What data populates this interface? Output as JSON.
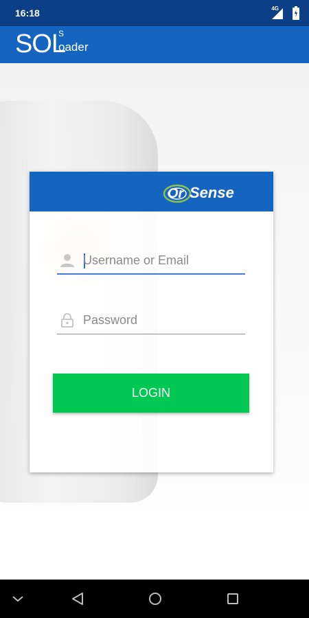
{
  "status_bar": {
    "time": "16:18",
    "network": "4G",
    "icons": [
      "signal-icon",
      "battery-icon"
    ]
  },
  "app_bar": {
    "logo_main": "SOL",
    "logo_superscript": "S",
    "logo_suffix": "oader"
  },
  "login_card": {
    "brand": "OrSense",
    "username": {
      "placeholder": "Username or Email",
      "value": "",
      "icon": "person-icon"
    },
    "password": {
      "placeholder": "Password",
      "value": "",
      "icon": "lock-icon"
    },
    "login_label": "LOGIN"
  },
  "nav_bar": {
    "buttons": [
      "chevron-down-icon",
      "back-icon",
      "home-icon",
      "recents-icon"
    ]
  },
  "colors": {
    "status_bar": "#0c3f86",
    "app_bar": "#1565c0",
    "card_header": "#1565c0",
    "login_button": "#00c853",
    "input_focus": "#3f7ad6"
  }
}
